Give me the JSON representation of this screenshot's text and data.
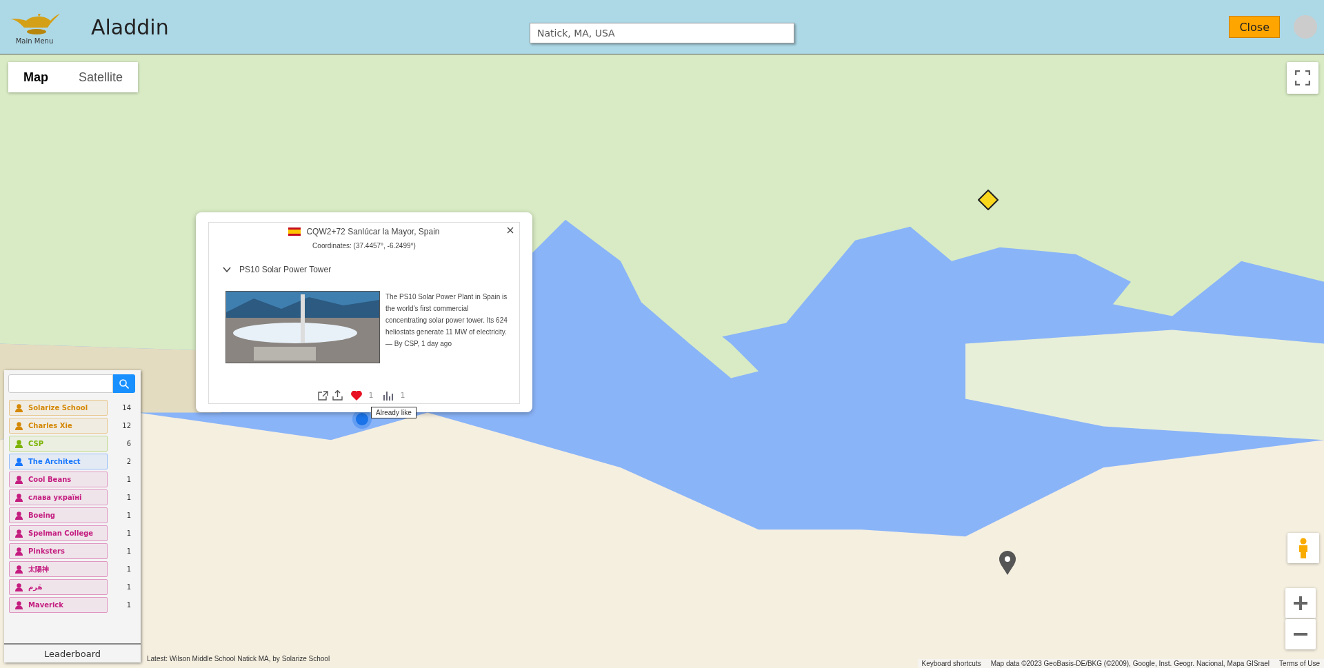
{
  "header": {
    "menu_label": "Main Menu",
    "title": "Aladdin",
    "search": {
      "value": "Natick, MA, USA"
    },
    "close_button": "Close"
  },
  "map_type_tabs": [
    {
      "label": "Map",
      "selected": true
    },
    {
      "label": "Satellite",
      "selected": false
    }
  ],
  "popup": {
    "address": "CQW2+72 Sanlúcar la Mayor, Spain",
    "coordinates": "Coordinates: (37.4457°, -6.2499°)",
    "title": "PS10 Solar Power Tower",
    "expanded": true,
    "description": "The PS10 Solar Power Plant in Spain is the world's first commercial concentrating solar power tower. Its 624 heliostats generate 11 MW of electricity. —  By CSP, 1 day ago",
    "liked": true,
    "like_count": "1",
    "view_count": "1",
    "tooltip": "Already like"
  },
  "leaderboard": {
    "entries": [
      {
        "name": "Solarize School",
        "count": "14",
        "color": "#d48806"
      },
      {
        "name": "Charles Xie",
        "count": "12",
        "color": "#d48806"
      },
      {
        "name": "CSP",
        "count": "6",
        "color": "#7cb305"
      },
      {
        "name": "The Architect",
        "count": "2",
        "color": "#1677ff"
      },
      {
        "name": "Cool Beans",
        "count": "1",
        "color": "#c41d7f"
      },
      {
        "name": "слава україні",
        "count": "1",
        "color": "#c41d7f"
      },
      {
        "name": "Boeing",
        "count": "1",
        "color": "#c41d7f"
      },
      {
        "name": "Spelman College",
        "count": "1",
        "color": "#c41d7f"
      },
      {
        "name": "Pinksters",
        "count": "1",
        "color": "#c41d7f"
      },
      {
        "name": "太陽神",
        "count": "1",
        "color": "#c41d7f"
      },
      {
        "name": "هَرم",
        "count": "1",
        "color": "#c41d7f"
      },
      {
        "name": "Maverick",
        "count": "1",
        "color": "#c41d7f"
      }
    ],
    "title": "Leaderboard"
  },
  "latest": "Latest: Wilson Middle School Natick MA, by Solarize School",
  "attribution": {
    "shortcuts": "Keyboard shortcuts",
    "map_data": "Map data ©2023 GeoBasis-DE/BKG (©2009), Google, Inst. Geogr. Nacional, Mapa GISrael",
    "terms": "Terms of Use"
  }
}
